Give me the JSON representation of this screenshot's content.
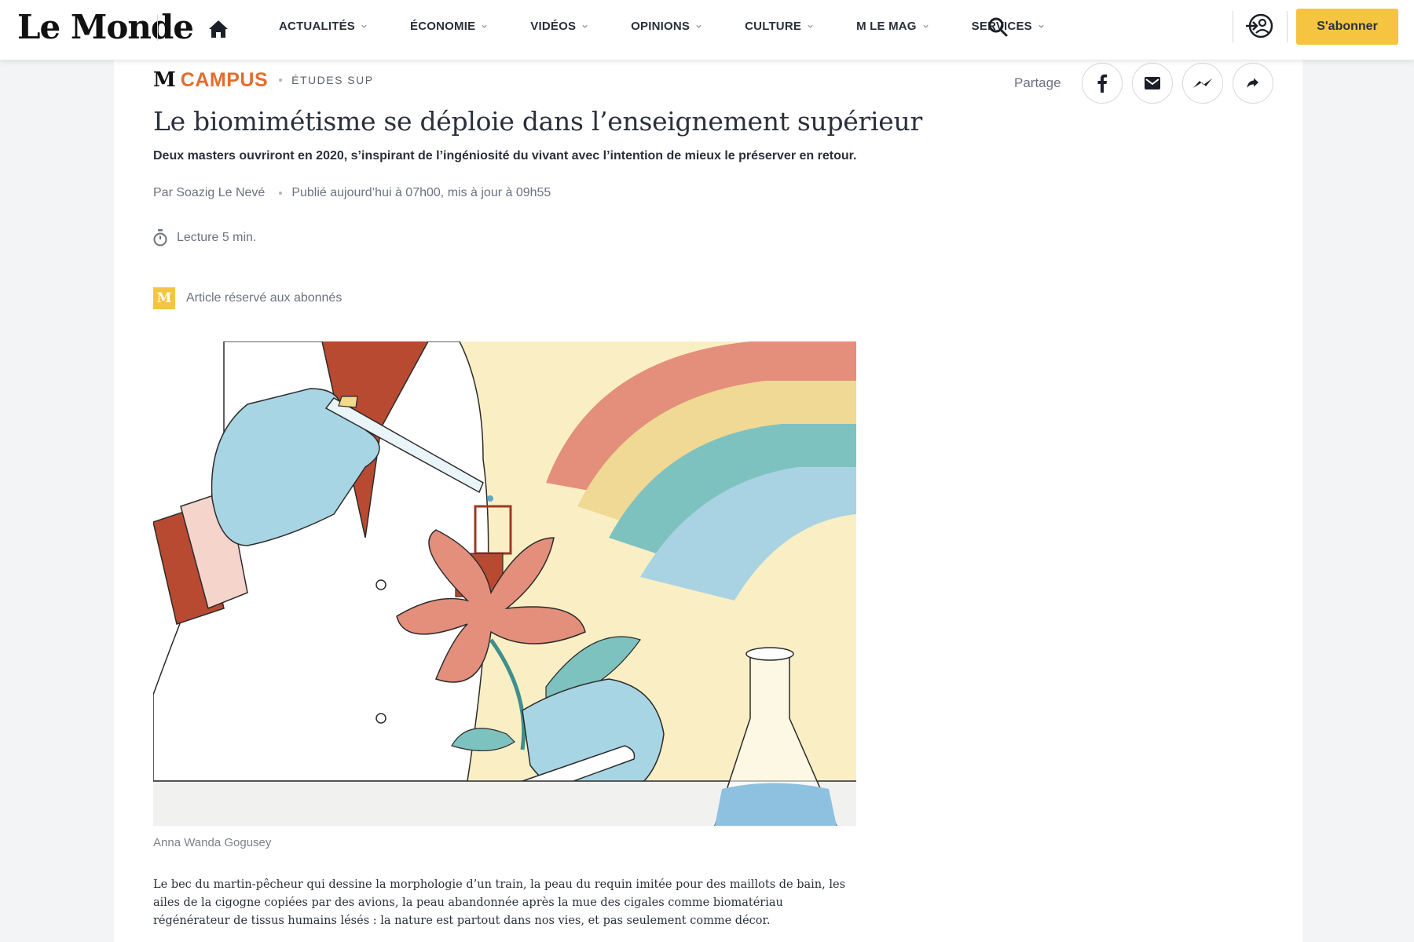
{
  "header": {
    "logo": "Le Monde",
    "nav": [
      {
        "label": "ACTUALITÉS",
        "has_dropdown": true
      },
      {
        "label": "ÉCONOMIE",
        "has_dropdown": true
      },
      {
        "label": "VIDÉOS",
        "has_dropdown": true
      },
      {
        "label": "OPINIONS",
        "has_dropdown": true
      },
      {
        "label": "CULTURE",
        "has_dropdown": true
      },
      {
        "label": "M LE MAG",
        "has_dropdown": true
      },
      {
        "label": "SERVICES",
        "has_dropdown": true
      }
    ],
    "icons": {
      "home": "home-icon",
      "search": "search-icon",
      "account": "login-account-icon"
    },
    "subscribe_label": "S'abonner"
  },
  "article": {
    "kicker": {
      "brand_mark": "M",
      "brand": "CAMPUS",
      "section": "ÉTUDES SUP"
    },
    "share": {
      "label": "Partage",
      "buttons": [
        "facebook-icon",
        "email-icon",
        "messenger-icon",
        "share-arrow-icon"
      ]
    },
    "title": "Le biomimétisme se déploie dans l’enseignement supérieur",
    "description": "Deux masters ouvriront en 2020, s’inspirant de l’ingéniosité du vivant avec l’intention de mieux le préserver en retour.",
    "author": "Par Soazig Le Nevé",
    "published": "Publié aujourd’hui à 07h00, mis à jour à 09h55",
    "reading_time": "Lecture 5 min.",
    "premium_badge": "M",
    "premium_label": "Article réservé aux abonnés",
    "image_caption": "Anna Wanda Gogusey",
    "body": "Le bec du martin-pêcheur qui dessine la morphologie d’un train, la peau du requin imitée pour des maillots de bain, les ailes de la cigogne copiées par des avions, la peau abandonnée après la mue des cigales comme biomatériau régénérateur de tissus humains lésés : la nature est partout dans nos vies, et pas seulement comme décor."
  },
  "colors": {
    "accent_yellow": "#f5c542",
    "campus_orange": "#e46d2c",
    "text_dark": "#2a303b",
    "text_muted": "#6b7280"
  }
}
